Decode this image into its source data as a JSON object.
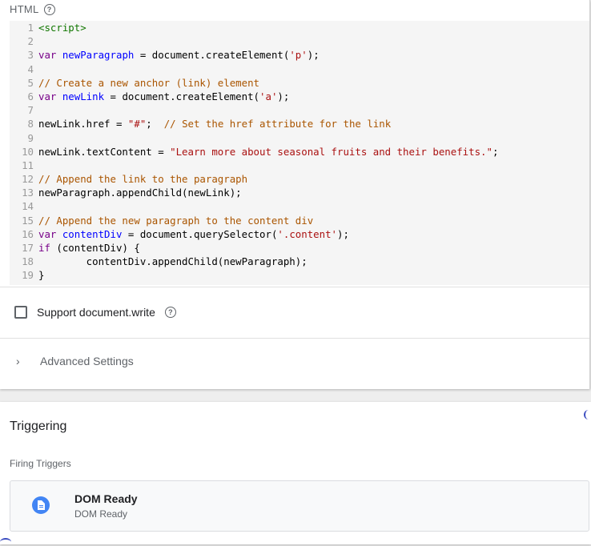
{
  "html_section": {
    "label": "HTML"
  },
  "code_lines": [
    {
      "n": "1",
      "tokens": [
        [
          "tag",
          "<script>"
        ]
      ]
    },
    {
      "n": "2",
      "tokens": []
    },
    {
      "n": "3",
      "tokens": [
        [
          "kw",
          "var "
        ],
        [
          "def",
          "newParagraph"
        ],
        [
          "plain",
          " = document.createElement("
        ],
        [
          "str",
          "'p'"
        ],
        [
          "plain",
          ");"
        ]
      ]
    },
    {
      "n": "4",
      "tokens": []
    },
    {
      "n": "5",
      "tokens": [
        [
          "com",
          "// Create a new anchor (link) element"
        ]
      ]
    },
    {
      "n": "6",
      "tokens": [
        [
          "kw",
          "var "
        ],
        [
          "def",
          "newLink"
        ],
        [
          "plain",
          " = document.createElement("
        ],
        [
          "str",
          "'a'"
        ],
        [
          "plain",
          ");"
        ]
      ]
    },
    {
      "n": "7",
      "tokens": []
    },
    {
      "n": "8",
      "tokens": [
        [
          "plain",
          "newLink.href = "
        ],
        [
          "str",
          "\"#\""
        ],
        [
          "plain",
          ";  "
        ],
        [
          "com",
          "// Set the href attribute for the link"
        ]
      ]
    },
    {
      "n": "9",
      "tokens": []
    },
    {
      "n": "10",
      "tokens": [
        [
          "plain",
          "newLink.textContent = "
        ],
        [
          "str",
          "\"Learn more about seasonal fruits and their benefits.\""
        ],
        [
          "plain",
          ";"
        ]
      ]
    },
    {
      "n": "11",
      "tokens": []
    },
    {
      "n": "12",
      "tokens": [
        [
          "com",
          "// Append the link to the paragraph"
        ]
      ]
    },
    {
      "n": "13",
      "tokens": [
        [
          "plain",
          "newParagraph.appendChild(newLink);"
        ]
      ]
    },
    {
      "n": "14",
      "tokens": []
    },
    {
      "n": "15",
      "tokens": [
        [
          "com",
          "// Append the new paragraph to the content div"
        ]
      ]
    },
    {
      "n": "16",
      "tokens": [
        [
          "kw",
          "var "
        ],
        [
          "def",
          "contentDiv"
        ],
        [
          "plain",
          " = document.querySelector("
        ],
        [
          "str",
          "'.content'"
        ],
        [
          "plain",
          ");"
        ]
      ]
    },
    {
      "n": "17",
      "tokens": [
        [
          "kw",
          "if"
        ],
        [
          "plain",
          " (contentDiv) {"
        ]
      ]
    },
    {
      "n": "18",
      "tokens": [
        [
          "plain",
          "        contentDiv.appendChild(newParagraph);"
        ]
      ]
    },
    {
      "n": "19",
      "tokens": [
        [
          "plain",
          "}"
        ]
      ]
    }
  ],
  "support_write": {
    "label": "Support document.write",
    "checked": false
  },
  "advanced": {
    "label": "Advanced Settings"
  },
  "triggering": {
    "title": "Triggering",
    "firing_label": "Firing Triggers",
    "trigger": {
      "name": "DOM Ready",
      "type": "DOM Ready"
    }
  },
  "colors": {
    "accent": "#4285f4",
    "keyword": "#770088",
    "variable_def": "#0000ff",
    "string": "#aa1111",
    "comment": "#aa5500",
    "tag": "#117700"
  },
  "icons": [
    "help-icon",
    "chevron-right-icon",
    "document-icon"
  ]
}
